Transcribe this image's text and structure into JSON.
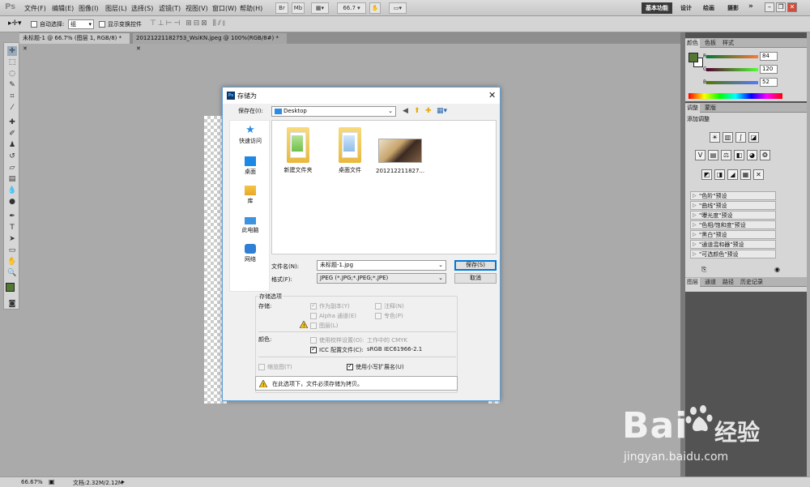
{
  "menubar": {
    "logo": "Ps",
    "items": [
      "文件(F)",
      "编辑(E)",
      "图像(I)",
      "图层(L)",
      "选择(S)",
      "滤镜(T)",
      "视图(V)",
      "窗口(W)",
      "帮助(H)"
    ],
    "zoom": "66.7",
    "workspaces": [
      "基本功能",
      "设计",
      "绘画",
      "摄影"
    ],
    "more": "»"
  },
  "optbar": {
    "auto_select_label": "自动选择:",
    "auto_select_value": "组",
    "transform_label": "显示变换控件"
  },
  "tabs": [
    {
      "label": "未标题-1 @ 66.7% (图层 1, RGB/8) *",
      "active": true
    },
    {
      "label": "20121221182753_WsiKN.jpeg @ 100%(RGB/8#) *",
      "active": false
    }
  ],
  "status": {
    "zoom": "66.67%",
    "doc": "文档:2.32M/2.12M"
  },
  "color_panel": {
    "tabs": [
      "颜色",
      "色板",
      "样式"
    ],
    "r_label": "R",
    "g_label": "G",
    "b_label": "B",
    "r": "84",
    "g": "120",
    "b": "52",
    "fg": "#547834"
  },
  "adjust_panel": {
    "tabs": [
      "调整",
      "蒙版"
    ],
    "title": "添加调整",
    "presets": [
      "\"色阶\"预设",
      "\"曲线\"预设",
      "\"曝光度\"预设",
      "\"色相/饱和度\"预设",
      "\"黑白\"预设",
      "\"通道混和器\"预设",
      "\"可选颜色\"预设"
    ]
  },
  "layers_panel": {
    "tabs": [
      "图层",
      "通道",
      "路径",
      "历史记录"
    ]
  },
  "dialog": {
    "title": "存储为",
    "save_in_label": "保存在(I):",
    "save_in_value": "Desktop",
    "places": [
      "快速访问",
      "桌面",
      "库",
      "此电脑",
      "网络"
    ],
    "files": [
      "新建文件夹",
      "桌面文件",
      "201212211827..."
    ],
    "filename_label": "文件名(N):",
    "filename_value": "未标题-1.jpg",
    "format_label": "格式(F):",
    "format_value": "JPEG (*.JPG;*.JPEG;*.JPE)",
    "save_button": "保存(S)",
    "cancel_button": "取消",
    "options_header": "存储选项",
    "store_label": "存储:",
    "as_copy": "作为副本(Y)",
    "notes": "注释(N)",
    "alpha": "Alpha 通道(E)",
    "spot": "专色(P)",
    "layers": "图层(L)",
    "color_label": "颜色:",
    "use_proof": "使用校样设置(O):",
    "proof_value": "工作中的 CMYK",
    "icc": "ICC 配置文件(C):",
    "icc_value": "sRGB IEC61966-2.1",
    "thumbnail": "缩览图(T)",
    "lowercase": "使用小写扩展名(U)",
    "notice": "在此选项下，文件必须存储为拷贝。"
  },
  "watermark": {
    "brand": "Bai",
    "brand2": "经验",
    "url": "jingyan.baidu.com"
  }
}
